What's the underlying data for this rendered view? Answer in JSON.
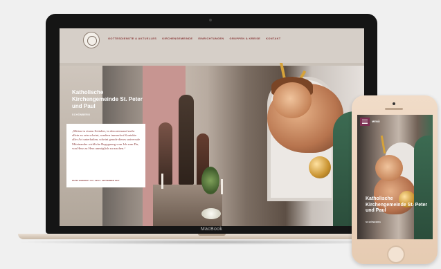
{
  "laptop": {
    "brand": "MacBook"
  },
  "site": {
    "nav": [
      "GOTTESDIENSTE & AKTUELLES",
      "KIRCHENGEMEINDE",
      "EINRICHTUNGEN",
      "GRUPPEN & KREISE",
      "KONTAKT"
    ],
    "hero": {
      "title": "Katholische Kirchengemeinde St. Peter und Paul",
      "subtitle": "SCHÖNBERG"
    },
    "quote": {
      "text": "„Mitten in einem Zeitalter, in dem niemand mehr allein zu sein scheint, sondern immerfort Kontakte aller Art unterhalten, scheint gerade dieses universale Miteinander wirkliche Begegnung vom Ich zum Du, von Herz zu Herz unmöglich zu machen.“",
      "source": "PAPST BENEDIKT XVI. AM 21. SEPTEMBER 2007"
    }
  },
  "phone": {
    "menu_label": "MENÜ",
    "title": "Katholische Kirchengemeinde St. Peter und Paul",
    "subtitle": "SCHÖNBERG"
  },
  "colors": {
    "accent": "#8c3b3b",
    "menu_button": "#7b2f52"
  }
}
